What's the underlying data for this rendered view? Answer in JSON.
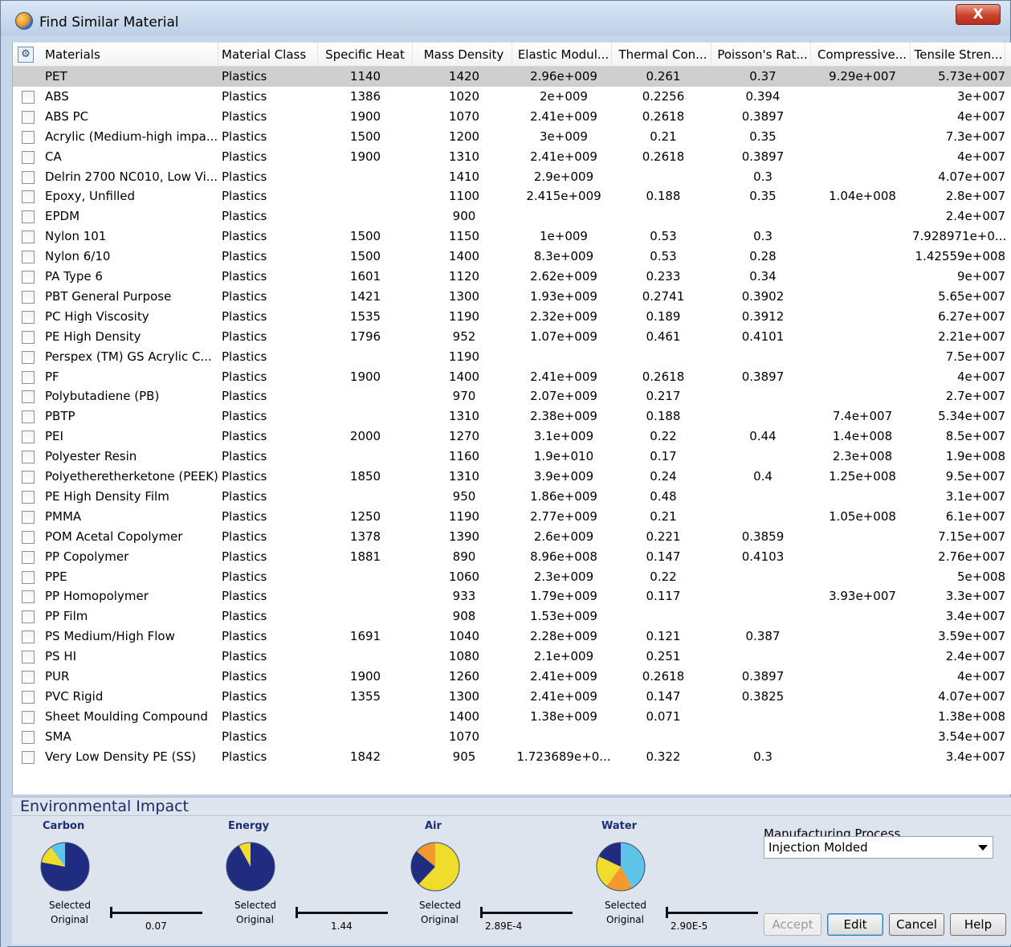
{
  "window": {
    "title": "Find Similar Material",
    "close_label": "X"
  },
  "columns": [
    {
      "key": "name",
      "label": "Materials"
    },
    {
      "key": "cls",
      "label": "Material Class"
    },
    {
      "key": "sh",
      "label": "Specific Heat"
    },
    {
      "key": "md",
      "label": "Mass Density"
    },
    {
      "key": "em",
      "label": "Elastic Modul..."
    },
    {
      "key": "tc",
      "label": "Thermal Con..."
    },
    {
      "key": "pr",
      "label": "Poisson's Rat..."
    },
    {
      "key": "cs",
      "label": "Compressive..."
    },
    {
      "key": "ts",
      "label": "Tensile Stren..."
    }
  ],
  "rows": [
    {
      "name": "PET",
      "cls": "Plastics",
      "sh": "1140",
      "md": "1420",
      "em": "2.96e+009",
      "tc": "0.261",
      "pr": "0.37",
      "cs": "9.29e+007",
      "ts": "5.73e+007",
      "selected": true
    },
    {
      "name": "ABS",
      "cls": "Plastics",
      "sh": "1386",
      "md": "1020",
      "em": "2e+009",
      "tc": "0.2256",
      "pr": "0.394",
      "cs": "",
      "ts": "3e+007"
    },
    {
      "name": "ABS PC",
      "cls": "Plastics",
      "sh": "1900",
      "md": "1070",
      "em": "2.41e+009",
      "tc": "0.2618",
      "pr": "0.3897",
      "cs": "",
      "ts": "4e+007"
    },
    {
      "name": "Acrylic (Medium-high impa...",
      "cls": "Plastics",
      "sh": "1500",
      "md": "1200",
      "em": "3e+009",
      "tc": "0.21",
      "pr": "0.35",
      "cs": "",
      "ts": "7.3e+007"
    },
    {
      "name": "CA",
      "cls": "Plastics",
      "sh": "1900",
      "md": "1310",
      "em": "2.41e+009",
      "tc": "0.2618",
      "pr": "0.3897",
      "cs": "",
      "ts": "4e+007"
    },
    {
      "name": "Delrin 2700 NC010, Low Vi...",
      "cls": "Plastics",
      "sh": "",
      "md": "1410",
      "em": "2.9e+009",
      "tc": "",
      "pr": "0.3",
      "cs": "",
      "ts": "4.07e+007"
    },
    {
      "name": "Epoxy, Unfilled",
      "cls": "Plastics",
      "sh": "",
      "md": "1100",
      "em": "2.415e+009",
      "tc": "0.188",
      "pr": "0.35",
      "cs": "1.04e+008",
      "ts": "2.8e+007"
    },
    {
      "name": "EPDM",
      "cls": "Plastics",
      "sh": "",
      "md": "900",
      "em": "",
      "tc": "",
      "pr": "",
      "cs": "",
      "ts": "2.4e+007"
    },
    {
      "name": "Nylon 101",
      "cls": "Plastics",
      "sh": "1500",
      "md": "1150",
      "em": "1e+009",
      "tc": "0.53",
      "pr": "0.3",
      "cs": "",
      "ts": "7.928971e+0..."
    },
    {
      "name": "Nylon 6/10",
      "cls": "Plastics",
      "sh": "1500",
      "md": "1400",
      "em": "8.3e+009",
      "tc": "0.53",
      "pr": "0.28",
      "cs": "",
      "ts": "1.42559e+008"
    },
    {
      "name": "PA Type 6",
      "cls": "Plastics",
      "sh": "1601",
      "md": "1120",
      "em": "2.62e+009",
      "tc": "0.233",
      "pr": "0.34",
      "cs": "",
      "ts": "9e+007"
    },
    {
      "name": "PBT General Purpose",
      "cls": "Plastics",
      "sh": "1421",
      "md": "1300",
      "em": "1.93e+009",
      "tc": "0.2741",
      "pr": "0.3902",
      "cs": "",
      "ts": "5.65e+007"
    },
    {
      "name": "PC High Viscosity",
      "cls": "Plastics",
      "sh": "1535",
      "md": "1190",
      "em": "2.32e+009",
      "tc": "0.189",
      "pr": "0.3912",
      "cs": "",
      "ts": "6.27e+007"
    },
    {
      "name": "PE High Density",
      "cls": "Plastics",
      "sh": "1796",
      "md": "952",
      "em": "1.07e+009",
      "tc": "0.461",
      "pr": "0.4101",
      "cs": "",
      "ts": "2.21e+007"
    },
    {
      "name": "Perspex (TM) GS Acrylic C...",
      "cls": "Plastics",
      "sh": "",
      "md": "1190",
      "em": "",
      "tc": "",
      "pr": "",
      "cs": "",
      "ts": "7.5e+007"
    },
    {
      "name": "PF",
      "cls": "Plastics",
      "sh": "1900",
      "md": "1400",
      "em": "2.41e+009",
      "tc": "0.2618",
      "pr": "0.3897",
      "cs": "",
      "ts": "4e+007"
    },
    {
      "name": "Polybutadiene (PB)",
      "cls": "Plastics",
      "sh": "",
      "md": "970",
      "em": "2.07e+009",
      "tc": "0.217",
      "pr": "",
      "cs": "",
      "ts": "2.7e+007"
    },
    {
      "name": "PBTP",
      "cls": "Plastics",
      "sh": "",
      "md": "1310",
      "em": "2.38e+009",
      "tc": "0.188",
      "pr": "",
      "cs": "7.4e+007",
      "ts": "5.34e+007"
    },
    {
      "name": "PEI",
      "cls": "Plastics",
      "sh": "2000",
      "md": "1270",
      "em": "3.1e+009",
      "tc": "0.22",
      "pr": "0.44",
      "cs": "1.4e+008",
      "ts": "8.5e+007"
    },
    {
      "name": "Polyester Resin",
      "cls": "Plastics",
      "sh": "",
      "md": "1160",
      "em": "1.9e+010",
      "tc": "0.17",
      "pr": "",
      "cs": "2.3e+008",
      "ts": "1.9e+008"
    },
    {
      "name": "Polyetheretherketone (PEEK)",
      "cls": "Plastics",
      "sh": "1850",
      "md": "1310",
      "em": "3.9e+009",
      "tc": "0.24",
      "pr": "0.4",
      "cs": "1.25e+008",
      "ts": "9.5e+007"
    },
    {
      "name": "PE High Density Film",
      "cls": "Plastics",
      "sh": "",
      "md": "950",
      "em": "1.86e+009",
      "tc": "0.48",
      "pr": "",
      "cs": "",
      "ts": "3.1e+007"
    },
    {
      "name": "PMMA",
      "cls": "Plastics",
      "sh": "1250",
      "md": "1190",
      "em": "2.77e+009",
      "tc": "0.21",
      "pr": "",
      "cs": "1.05e+008",
      "ts": "6.1e+007"
    },
    {
      "name": "POM Acetal Copolymer",
      "cls": "Plastics",
      "sh": "1378",
      "md": "1390",
      "em": "2.6e+009",
      "tc": "0.221",
      "pr": "0.3859",
      "cs": "",
      "ts": "7.15e+007"
    },
    {
      "name": "PP Copolymer",
      "cls": "Plastics",
      "sh": "1881",
      "md": "890",
      "em": "8.96e+008",
      "tc": "0.147",
      "pr": "0.4103",
      "cs": "",
      "ts": "2.76e+007"
    },
    {
      "name": "PPE",
      "cls": "Plastics",
      "sh": "",
      "md": "1060",
      "em": "2.3e+009",
      "tc": "0.22",
      "pr": "",
      "cs": "",
      "ts": "5e+008"
    },
    {
      "name": "PP Homopolymer",
      "cls": "Plastics",
      "sh": "",
      "md": "933",
      "em": "1.79e+009",
      "tc": "0.117",
      "pr": "",
      "cs": "3.93e+007",
      "ts": "3.3e+007"
    },
    {
      "name": "PP Film",
      "cls": "Plastics",
      "sh": "",
      "md": "908",
      "em": "1.53e+009",
      "tc": "",
      "pr": "",
      "cs": "",
      "ts": "3.4e+007"
    },
    {
      "name": "PS Medium/High Flow",
      "cls": "Plastics",
      "sh": "1691",
      "md": "1040",
      "em": "2.28e+009",
      "tc": "0.121",
      "pr": "0.387",
      "cs": "",
      "ts": "3.59e+007"
    },
    {
      "name": "PS HI",
      "cls": "Plastics",
      "sh": "",
      "md": "1080",
      "em": "2.1e+009",
      "tc": "0.251",
      "pr": "",
      "cs": "",
      "ts": "2.4e+007"
    },
    {
      "name": "PUR",
      "cls": "Plastics",
      "sh": "1900",
      "md": "1260",
      "em": "2.41e+009",
      "tc": "0.2618",
      "pr": "0.3897",
      "cs": "",
      "ts": "4e+007"
    },
    {
      "name": "PVC Rigid",
      "cls": "Plastics",
      "sh": "1355",
      "md": "1300",
      "em": "2.41e+009",
      "tc": "0.147",
      "pr": "0.3825",
      "cs": "",
      "ts": "4.07e+007"
    },
    {
      "name": "Sheet Moulding Compound",
      "cls": "Plastics",
      "sh": "",
      "md": "1400",
      "em": "1.38e+009",
      "tc": "0.071",
      "pr": "",
      "cs": "",
      "ts": "1.38e+008"
    },
    {
      "name": "SMA",
      "cls": "Plastics",
      "sh": "",
      "md": "1070",
      "em": "",
      "tc": "",
      "pr": "",
      "cs": "",
      "ts": "3.54e+007"
    },
    {
      "name": "Very Low Density PE (SS)",
      "cls": "Plastics",
      "sh": "1842",
      "md": "905",
      "em": "1.723689e+0...",
      "tc": "0.322",
      "pr": "0.3",
      "cs": "",
      "ts": "3.4e+007"
    }
  ],
  "environment": {
    "title": "Environmental Impact",
    "selected_label": "Selected",
    "original_label": "Original",
    "metrics": [
      {
        "name": "Carbon",
        "value": "0.07",
        "slices": [
          {
            "fraction": 0.78,
            "color": "#1f2c80"
          },
          {
            "fraction": 0.12,
            "color": "#f0dc2a"
          },
          {
            "fraction": 0.1,
            "color": "#5fc4e8"
          }
        ]
      },
      {
        "name": "Energy",
        "value": "1.44",
        "slices": [
          {
            "fraction": 0.92,
            "color": "#1f2c80"
          },
          {
            "fraction": 0.08,
            "color": "#f0dc2a"
          }
        ]
      },
      {
        "name": "Air",
        "value": "2.89E-4",
        "slices": [
          {
            "fraction": 0.62,
            "color": "#f0dc2a"
          },
          {
            "fraction": 0.24,
            "color": "#1f2c80"
          },
          {
            "fraction": 0.14,
            "color": "#f29a2e"
          }
        ]
      },
      {
        "name": "Water",
        "value": "2.90E-5",
        "slices": [
          {
            "fraction": 0.42,
            "color": "#5fc4e8"
          },
          {
            "fraction": 0.18,
            "color": "#f29a2e"
          },
          {
            "fraction": 0.22,
            "color": "#f0dc2a"
          },
          {
            "fraction": 0.18,
            "color": "#1f2c80"
          }
        ]
      }
    ],
    "manufacturing_process": {
      "label": "Manufacturing Process",
      "value": "Injection Molded"
    }
  },
  "buttons": {
    "accept": "Accept",
    "edit": "Edit",
    "cancel": "Cancel",
    "help": "Help"
  }
}
